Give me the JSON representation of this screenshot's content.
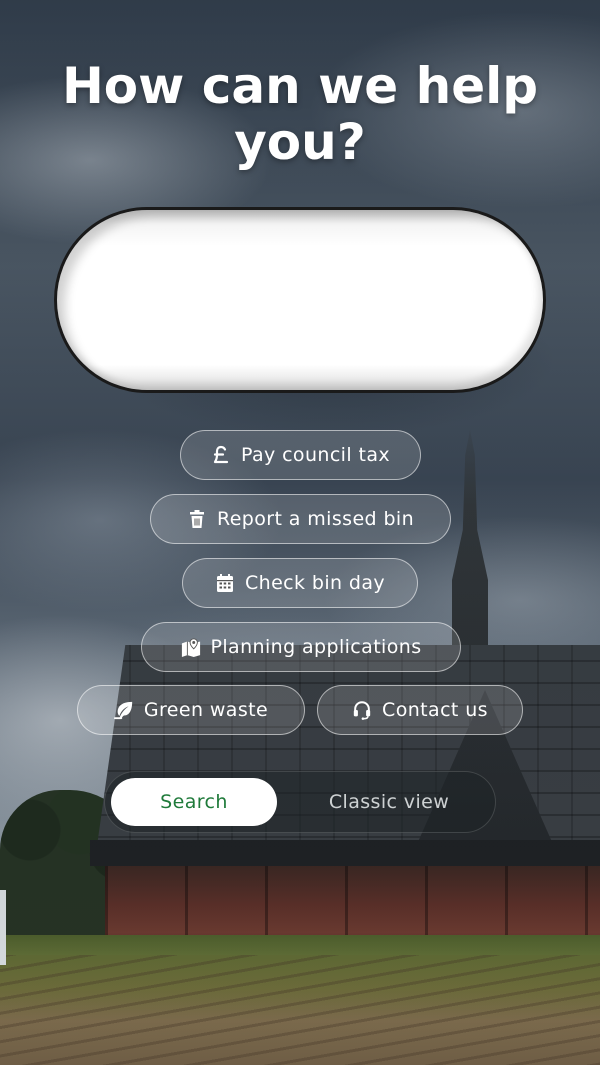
{
  "hero": {
    "headline": "How can we help you?"
  },
  "search": {
    "value": "",
    "placeholder": ""
  },
  "quick_links": [
    {
      "label": "Pay council tax",
      "icon": "pound-icon"
    },
    {
      "label": "Report a missed bin",
      "icon": "trash-icon"
    },
    {
      "label": "Check bin day",
      "icon": "calendar-icon"
    },
    {
      "label": "Planning applications",
      "icon": "map-pin-icon"
    },
    {
      "label": "Green waste",
      "icon": "leaf-icon"
    },
    {
      "label": "Contact us",
      "icon": "headset-icon"
    }
  ],
  "view_toggle": {
    "active": "Search",
    "options": [
      "Search",
      "Classic view"
    ]
  },
  "colors": {
    "active_text": "#1f7a3a",
    "chip_text": "#ffffff"
  }
}
